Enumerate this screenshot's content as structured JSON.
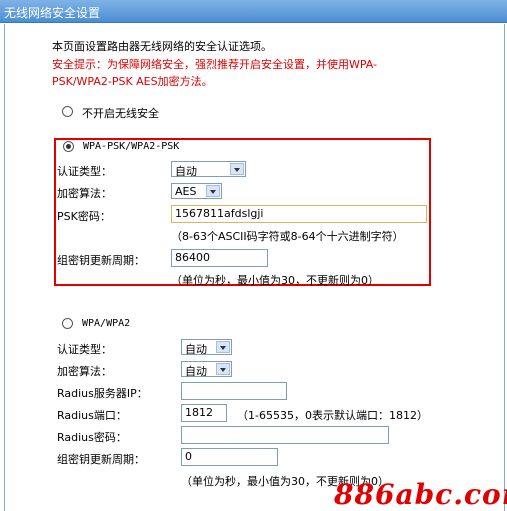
{
  "title": "无线网络安全设置",
  "intro": "本页面设置路由器无线网络的安全认证选项。",
  "warning_line1": "安全提示：为保障网络安全，强烈推荐开启安全设置，并使用WPA-",
  "warning_line2": "PSK/WPA2-PSK AES加密方法。",
  "no_security_label": "不开启无线安全",
  "psk": {
    "radio_label": "WPA-PSK/WPA2-PSK",
    "auth_label": "认证类型：",
    "auth_value": "自动",
    "enc_label": "加密算法：",
    "enc_value": "AES",
    "key_label": "PSK密码：",
    "key_value": "1567811afdslgji",
    "key_hint": "（8-63个ASCII码字符或8-64个十六进制字符）",
    "renew_label": "组密钥更新周期：",
    "renew_value": "86400",
    "renew_hint": "（单位为秒，最小值为30，不更新则为0）"
  },
  "wpa": {
    "radio_label": "WPA/WPA2",
    "auth_label": "认证类型：",
    "auth_value": "自动",
    "enc_label": "加密算法：",
    "enc_value": "自动",
    "radius_ip_label": "Radius服务器IP：",
    "radius_ip_value": "",
    "radius_port_label": "Radius端口：",
    "radius_port_value": "1812",
    "radius_port_hint": "（1-65535，0表示默认端口：1812）",
    "radius_pw_label": "Radius密码：",
    "radius_pw_value": "",
    "renew_label": "组密钥更新周期：",
    "renew_value": "0",
    "renew_hint": "（单位为秒，最小值为30，不更新则为0）"
  },
  "watermark": "886abc.com",
  "colors": {
    "title_bar": "#4a8ed3",
    "warning": "#e00000",
    "highlight_box": "#e00000"
  }
}
